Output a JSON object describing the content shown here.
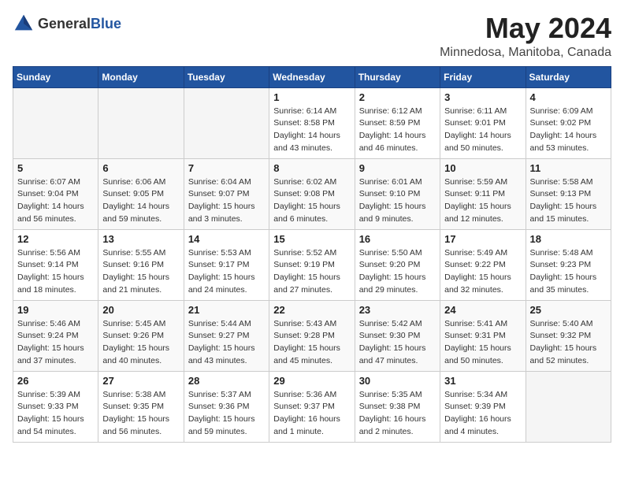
{
  "header": {
    "logo_general": "General",
    "logo_blue": "Blue",
    "month": "May 2024",
    "location": "Minnedosa, Manitoba, Canada"
  },
  "weekdays": [
    "Sunday",
    "Monday",
    "Tuesday",
    "Wednesday",
    "Thursday",
    "Friday",
    "Saturday"
  ],
  "weeks": [
    [
      {
        "day": "",
        "info": ""
      },
      {
        "day": "",
        "info": ""
      },
      {
        "day": "",
        "info": ""
      },
      {
        "day": "1",
        "info": "Sunrise: 6:14 AM\nSunset: 8:58 PM\nDaylight: 14 hours\nand 43 minutes."
      },
      {
        "day": "2",
        "info": "Sunrise: 6:12 AM\nSunset: 8:59 PM\nDaylight: 14 hours\nand 46 minutes."
      },
      {
        "day": "3",
        "info": "Sunrise: 6:11 AM\nSunset: 9:01 PM\nDaylight: 14 hours\nand 50 minutes."
      },
      {
        "day": "4",
        "info": "Sunrise: 6:09 AM\nSunset: 9:02 PM\nDaylight: 14 hours\nand 53 minutes."
      }
    ],
    [
      {
        "day": "5",
        "info": "Sunrise: 6:07 AM\nSunset: 9:04 PM\nDaylight: 14 hours\nand 56 minutes."
      },
      {
        "day": "6",
        "info": "Sunrise: 6:06 AM\nSunset: 9:05 PM\nDaylight: 14 hours\nand 59 minutes."
      },
      {
        "day": "7",
        "info": "Sunrise: 6:04 AM\nSunset: 9:07 PM\nDaylight: 15 hours\nand 3 minutes."
      },
      {
        "day": "8",
        "info": "Sunrise: 6:02 AM\nSunset: 9:08 PM\nDaylight: 15 hours\nand 6 minutes."
      },
      {
        "day": "9",
        "info": "Sunrise: 6:01 AM\nSunset: 9:10 PM\nDaylight: 15 hours\nand 9 minutes."
      },
      {
        "day": "10",
        "info": "Sunrise: 5:59 AM\nSunset: 9:11 PM\nDaylight: 15 hours\nand 12 minutes."
      },
      {
        "day": "11",
        "info": "Sunrise: 5:58 AM\nSunset: 9:13 PM\nDaylight: 15 hours\nand 15 minutes."
      }
    ],
    [
      {
        "day": "12",
        "info": "Sunrise: 5:56 AM\nSunset: 9:14 PM\nDaylight: 15 hours\nand 18 minutes."
      },
      {
        "day": "13",
        "info": "Sunrise: 5:55 AM\nSunset: 9:16 PM\nDaylight: 15 hours\nand 21 minutes."
      },
      {
        "day": "14",
        "info": "Sunrise: 5:53 AM\nSunset: 9:17 PM\nDaylight: 15 hours\nand 24 minutes."
      },
      {
        "day": "15",
        "info": "Sunrise: 5:52 AM\nSunset: 9:19 PM\nDaylight: 15 hours\nand 27 minutes."
      },
      {
        "day": "16",
        "info": "Sunrise: 5:50 AM\nSunset: 9:20 PM\nDaylight: 15 hours\nand 29 minutes."
      },
      {
        "day": "17",
        "info": "Sunrise: 5:49 AM\nSunset: 9:22 PM\nDaylight: 15 hours\nand 32 minutes."
      },
      {
        "day": "18",
        "info": "Sunrise: 5:48 AM\nSunset: 9:23 PM\nDaylight: 15 hours\nand 35 minutes."
      }
    ],
    [
      {
        "day": "19",
        "info": "Sunrise: 5:46 AM\nSunset: 9:24 PM\nDaylight: 15 hours\nand 37 minutes."
      },
      {
        "day": "20",
        "info": "Sunrise: 5:45 AM\nSunset: 9:26 PM\nDaylight: 15 hours\nand 40 minutes."
      },
      {
        "day": "21",
        "info": "Sunrise: 5:44 AM\nSunset: 9:27 PM\nDaylight: 15 hours\nand 43 minutes."
      },
      {
        "day": "22",
        "info": "Sunrise: 5:43 AM\nSunset: 9:28 PM\nDaylight: 15 hours\nand 45 minutes."
      },
      {
        "day": "23",
        "info": "Sunrise: 5:42 AM\nSunset: 9:30 PM\nDaylight: 15 hours\nand 47 minutes."
      },
      {
        "day": "24",
        "info": "Sunrise: 5:41 AM\nSunset: 9:31 PM\nDaylight: 15 hours\nand 50 minutes."
      },
      {
        "day": "25",
        "info": "Sunrise: 5:40 AM\nSunset: 9:32 PM\nDaylight: 15 hours\nand 52 minutes."
      }
    ],
    [
      {
        "day": "26",
        "info": "Sunrise: 5:39 AM\nSunset: 9:33 PM\nDaylight: 15 hours\nand 54 minutes."
      },
      {
        "day": "27",
        "info": "Sunrise: 5:38 AM\nSunset: 9:35 PM\nDaylight: 15 hours\nand 56 minutes."
      },
      {
        "day": "28",
        "info": "Sunrise: 5:37 AM\nSunset: 9:36 PM\nDaylight: 15 hours\nand 59 minutes."
      },
      {
        "day": "29",
        "info": "Sunrise: 5:36 AM\nSunset: 9:37 PM\nDaylight: 16 hours\nand 1 minute."
      },
      {
        "day": "30",
        "info": "Sunrise: 5:35 AM\nSunset: 9:38 PM\nDaylight: 16 hours\nand 2 minutes."
      },
      {
        "day": "31",
        "info": "Sunrise: 5:34 AM\nSunset: 9:39 PM\nDaylight: 16 hours\nand 4 minutes."
      },
      {
        "day": "",
        "info": ""
      }
    ]
  ]
}
